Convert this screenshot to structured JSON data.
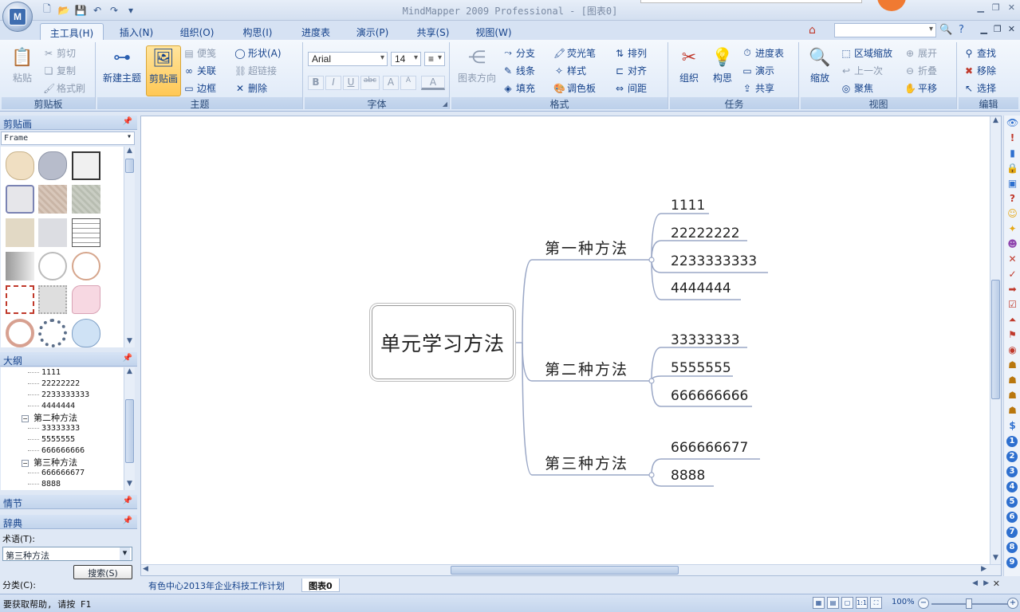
{
  "window": {
    "title": "MindMapper 2009 Professional - [图表0]"
  },
  "tabs": [
    "主工具(H)",
    "插入(N)",
    "组织(O)",
    "构思(I)",
    "进度表",
    "演示(P)",
    "共享(S)",
    "视图(W)"
  ],
  "ribbon": {
    "clipboard": {
      "paste": "粘贴",
      "cut": "剪切",
      "copy": "复制",
      "format_painter": "格式刷",
      "label": "剪贴板"
    },
    "topic": {
      "new_topic": "新建主题",
      "clipart": "剪贴画",
      "note": "便笺",
      "relation": "关联",
      "border": "边框",
      "shape": "形状(A)",
      "hyperlink": "超链接",
      "delete": "删除",
      "label": "主题"
    },
    "font": {
      "family": "Arial",
      "size": "14",
      "bold": "B",
      "italic": "I",
      "underline": "U",
      "strike": "abc",
      "grow": "A",
      "shrink": "A",
      "color": "A",
      "label": "字体"
    },
    "format": {
      "direction": "图表方向",
      "branch": "分支",
      "line": "线条",
      "fill": "填充",
      "highlighter": "荧光笔",
      "style": "样式",
      "palette": "调色板",
      "arrange": "排列",
      "align": "对齐",
      "spacing": "间距",
      "label": "格式"
    },
    "task": {
      "organize": "组织",
      "idea": "构思",
      "schedule": "进度表",
      "present": "演示",
      "share": "共享",
      "label": "任务"
    },
    "view": {
      "zoom": "缩放",
      "area_zoom": "区域缩放",
      "previous": "上一次",
      "focus": "聚焦",
      "expand": "展开",
      "collapse": "折叠",
      "pan": "平移",
      "label": "视图"
    },
    "edit": {
      "find": "查找",
      "move": "移除",
      "select": "选择",
      "label": "编辑"
    }
  },
  "panels": {
    "clipart": {
      "title": "剪贴画",
      "category": "Frame"
    },
    "outline": {
      "title": "大纲",
      "items": [
        {
          "text": "1111",
          "level": 2
        },
        {
          "text": "22222222",
          "level": 2
        },
        {
          "text": "2233333333",
          "level": 2
        },
        {
          "text": "4444444",
          "level": 2
        },
        {
          "text": "第二种方法",
          "level": 1
        },
        {
          "text": "33333333",
          "level": 2
        },
        {
          "text": "5555555",
          "level": 2
        },
        {
          "text": "666666666",
          "level": 2
        },
        {
          "text": "第三种方法",
          "level": 1
        },
        {
          "text": "666666677",
          "level": 2
        },
        {
          "text": "8888",
          "level": 2
        }
      ]
    },
    "scene": {
      "title": "情节"
    },
    "dictionary": {
      "title": "辞典",
      "term_label": "术语(T):",
      "term_value": "第三种方法",
      "search_button": "搜索(S)",
      "category_label": "分类(C):"
    }
  },
  "mindmap": {
    "central": "单元学习方法",
    "branches": [
      {
        "label": "第一种方法",
        "leaves": [
          "1111",
          "22222222",
          "2233333333",
          "4444444"
        ]
      },
      {
        "label": "第二种方法",
        "leaves": [
          "33333333",
          "5555555",
          "666666666"
        ]
      },
      {
        "label": "第三种方法",
        "leaves": [
          "666666677",
          "8888"
        ]
      }
    ]
  },
  "doc_tabs": [
    "有色中心2013年企业科技工作计划",
    "图表0"
  ],
  "status": {
    "help": "要获取帮助, 请按 F1",
    "zoom": "100%"
  }
}
